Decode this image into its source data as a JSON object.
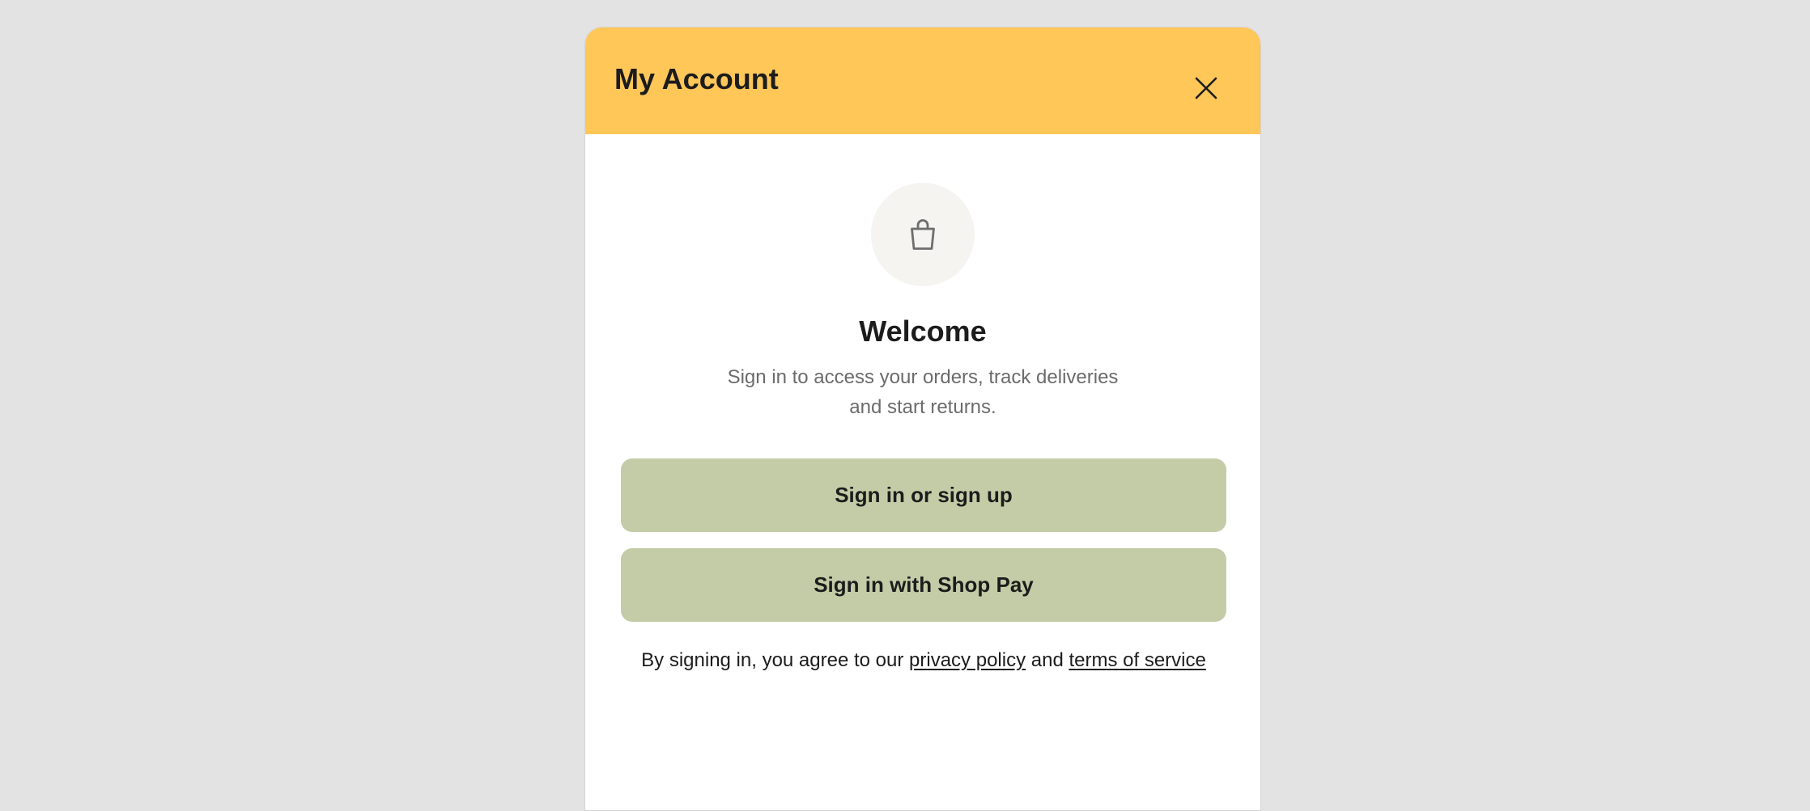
{
  "colors": {
    "background": "#e3e3e3",
    "header": "#ffc658",
    "button": "#c4cca7",
    "text": "#1c1c1c",
    "muted_text": "#6b6b6b",
    "icon_circle": "#f5f4f1"
  },
  "header": {
    "title": "My Account",
    "close_icon": "close-icon"
  },
  "hero": {
    "icon": "shopping-bag-icon",
    "title": "Welcome",
    "subtitle_line1": "Sign in to access your orders, track deliveries",
    "subtitle_line2": "and start returns."
  },
  "actions": {
    "sign_in_label": "Sign in or sign up",
    "shop_pay_label": "Sign in with Shop Pay"
  },
  "legal": {
    "prefix": "By signing in, you agree to our ",
    "privacy_link": "privacy policy",
    "conjunction": " and ",
    "terms_link": "terms of service"
  }
}
